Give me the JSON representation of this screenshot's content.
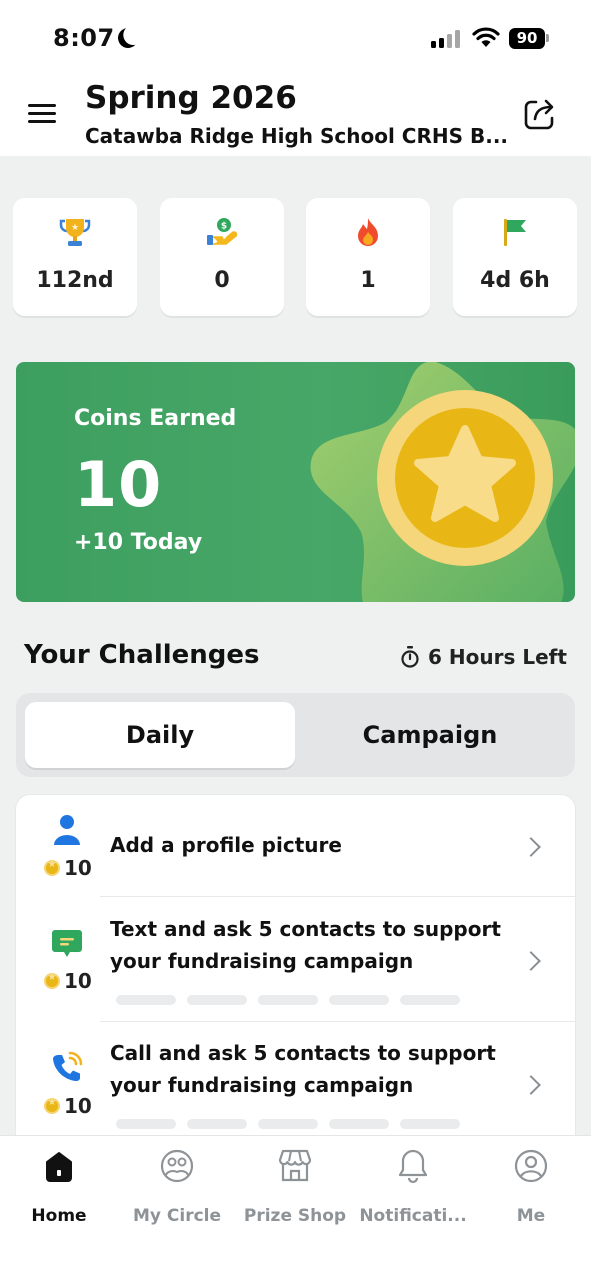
{
  "status_bar": {
    "time": "8:07",
    "battery": "90"
  },
  "header": {
    "title": "Spring 2026",
    "subtitle": "Catawba Ridge High School CRHS B..."
  },
  "stats": [
    {
      "icon": "trophy-icon",
      "value": "112nd"
    },
    {
      "icon": "donation-hand-icon",
      "value": "0"
    },
    {
      "icon": "fire-icon",
      "value": "1"
    },
    {
      "icon": "flag-icon",
      "value": "4d 6h"
    }
  ],
  "coins": {
    "label": "Coins Earned",
    "value": "10",
    "today": "+10 Today"
  },
  "challenges": {
    "title": "Your Challenges",
    "time_left": "6 Hours Left",
    "tabs": [
      {
        "label": "Daily",
        "selected": true
      },
      {
        "label": "Campaign",
        "selected": false
      }
    ],
    "items": [
      {
        "icon": "person-icon",
        "reward": "10",
        "text_lines": [
          "Add a profile picture"
        ]
      },
      {
        "icon": "chat-message-icon",
        "reward": "10",
        "text_lines": [
          "Text and ask 5 contacts to support",
          "your fundraising campaign"
        ]
      },
      {
        "icon": "phone-call-icon",
        "reward": "10",
        "text_lines": [
          "Call and ask 5 contacts to support",
          "your fundraising campaign"
        ]
      }
    ]
  },
  "nav": [
    {
      "label": "Home",
      "icon": "home-icon",
      "active": true
    },
    {
      "label": "My Circle",
      "icon": "circle-faces-icon",
      "active": false
    },
    {
      "label": "Prize Shop",
      "icon": "shop-icon",
      "active": false
    },
    {
      "label": "Notificati...",
      "icon": "bell-icon",
      "active": false
    },
    {
      "label": "Me",
      "icon": "user-profile-icon",
      "active": false
    }
  ],
  "colors": {
    "accent_green": "#47a768",
    "coin_gold": "#e9b715",
    "inactive_gray": "#8e9397"
  }
}
